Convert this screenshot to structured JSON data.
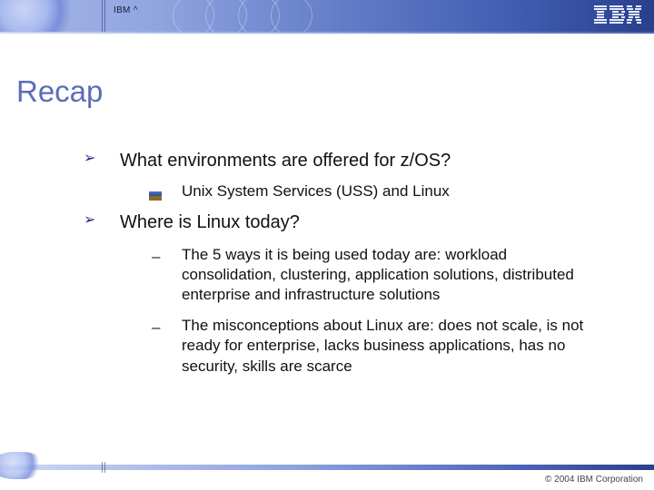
{
  "header": {
    "tag": "IBM ^"
  },
  "title": "Recap",
  "content": {
    "items": [
      {
        "text": "What environments are offered for z/OS?",
        "sub_pic": [
          "Unix System Services (USS) and Linux"
        ]
      },
      {
        "text": "Where is Linux today?",
        "sub_dash": [
          "The 5 ways it is being used today are: workload consolidation, clustering, application solutions, distributed enterprise and infrastructure solutions",
          "The misconceptions about Linux are: does not scale, is not ready for enterprise, lacks business applications, has no security, skills are scarce"
        ]
      }
    ]
  },
  "footer": {
    "copyright": "© 2004 IBM Corporation"
  }
}
